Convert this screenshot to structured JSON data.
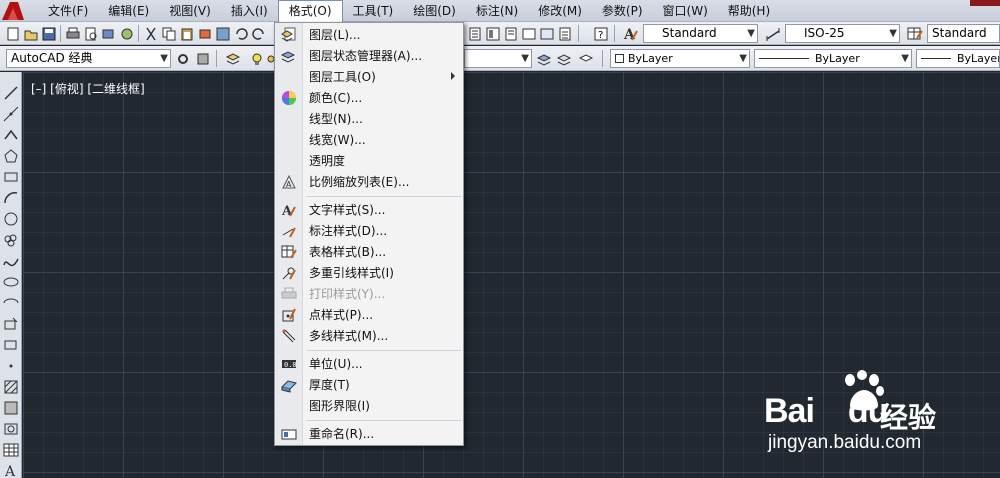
{
  "menubar": {
    "items": [
      {
        "label": "文件(F)"
      },
      {
        "label": "编辑(E)"
      },
      {
        "label": "视图(V)"
      },
      {
        "label": "插入(I)"
      },
      {
        "label": "格式(O)",
        "active": true
      },
      {
        "label": "工具(T)"
      },
      {
        "label": "绘图(D)"
      },
      {
        "label": "标注(N)"
      },
      {
        "label": "修改(M)"
      },
      {
        "label": "参数(P)"
      },
      {
        "label": "窗口(W)"
      },
      {
        "label": "帮助(H)"
      }
    ]
  },
  "toolbar1": {
    "text_style": "Standard",
    "dim_style": "ISO-25",
    "table_style": "Standard"
  },
  "toolbar2": {
    "workspace": "AutoCAD 经典",
    "color": "ByLayer",
    "linetype": "ByLayer",
    "lineweight": "ByLayer"
  },
  "canvas": {
    "viewport_label": "[–] [俯视] [二维线框]"
  },
  "format_menu": {
    "items": [
      {
        "label": "图层(L)...",
        "icon": "layer-icon"
      },
      {
        "label": "图层状态管理器(A)...",
        "icon": "layer-state-icon"
      },
      {
        "label": "图层工具(O)",
        "icon": "",
        "submenu": true
      },
      {
        "label": "颜色(C)...",
        "icon": "color-wheel-icon"
      },
      {
        "label": "线型(N)...",
        "icon": ""
      },
      {
        "label": "线宽(W)...",
        "icon": ""
      },
      {
        "label": "透明度",
        "icon": ""
      },
      {
        "label": "比例缩放列表(E)...",
        "icon": "scale-list-icon"
      },
      {
        "label": "文字样式(S)...",
        "icon": "text-style-icon"
      },
      {
        "label": "标注样式(D)...",
        "icon": "dim-style-icon"
      },
      {
        "label": "表格样式(B)...",
        "icon": "table-style-icon"
      },
      {
        "label": "多重引线样式(I)",
        "icon": "mleader-style-icon"
      },
      {
        "label": "打印样式(Y)...",
        "icon": "plot-style-icon",
        "disabled": true
      },
      {
        "label": "点样式(P)...",
        "icon": "point-style-icon"
      },
      {
        "label": "多线样式(M)...",
        "icon": "mline-style-icon"
      },
      {
        "label": "单位(U)...",
        "icon": "units-icon"
      },
      {
        "label": "厚度(T)",
        "icon": "thickness-icon"
      },
      {
        "label": "图形界限(I)",
        "icon": ""
      },
      {
        "label": "重命名(R)...",
        "icon": "rename-icon"
      }
    ]
  },
  "watermark": {
    "brand": "Bai",
    "brand_suffix": "du",
    "cn": "经验",
    "url": "jingyan.baidu.com"
  },
  "colors": {
    "canvas_bg": "#212830",
    "menu_bg": "#f3f3f3",
    "toolbar_bg": "#dde1e8"
  }
}
